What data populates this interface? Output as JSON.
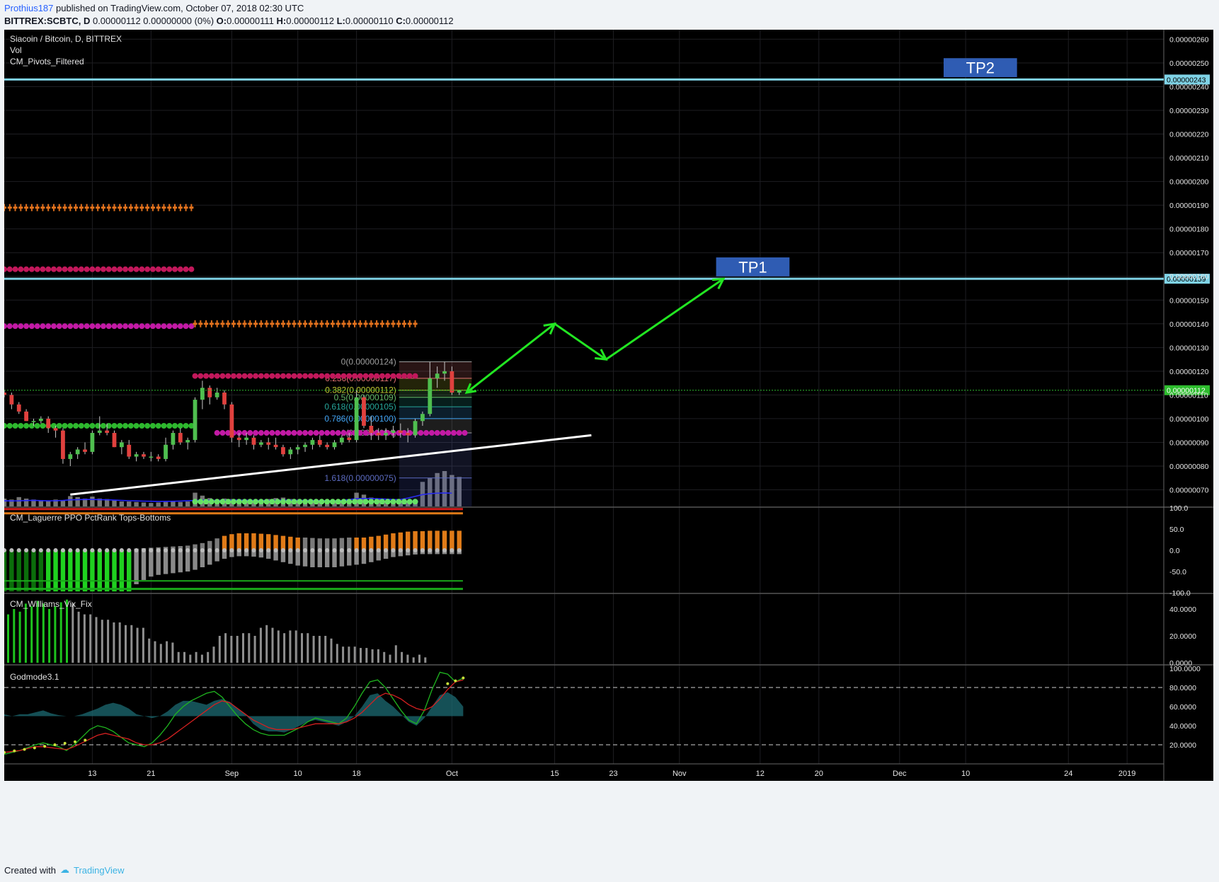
{
  "header": {
    "user": "Prothius187",
    "published": "published on TradingView.com, October 07, 2018 02:30 UTC",
    "symbol": "BITTREX:SCBTC, D",
    "change": "0.00000112 0.00000000 (0%)",
    "o_label": "O:",
    "o_value": "0.00000111",
    "h_label": "H:",
    "h_value": "0.00000112",
    "l_label": "L:",
    "l_value": "0.00000110",
    "c_label": "C:",
    "c_value": "0.00000112"
  },
  "footer": {
    "created": "Created with",
    "brand": "TradingView"
  },
  "chart_data": {
    "type": "candlestick",
    "title": "Siacoin / Bitcoin, D, BITTREX",
    "indicators": [
      "Vol",
      "CM_Pivots_Filtered"
    ],
    "price_axis": {
      "ticks": [
        "0.00000260",
        "0.00000250",
        "0.00000240",
        "0.00000230",
        "0.00000220",
        "0.00000210",
        "0.00000200",
        "0.00000190",
        "0.00000180",
        "0.00000170",
        "0.00000160",
        "0.00000150",
        "0.00000140",
        "0.00000130",
        "0.00000120",
        "0.00000110",
        "0.00000100",
        "0.00000090",
        "0.00000080",
        "0.00000070"
      ],
      "ylim": [
        6.3e-07,
        2.64e-06
      ]
    },
    "time_axis": {
      "ticks": [
        {
          "label": "13",
          "day": 12
        },
        {
          "label": "21",
          "day": 20
        },
        {
          "label": "Sep",
          "day": 31
        },
        {
          "label": "10",
          "day": 40
        },
        {
          "label": "18",
          "day": 48
        },
        {
          "label": "Oct",
          "day": 61
        },
        {
          "label": "15",
          "day": 75
        },
        {
          "label": "23",
          "day": 83
        },
        {
          "label": "Nov",
          "day": 92
        },
        {
          "label": "12",
          "day": 103
        },
        {
          "label": "20",
          "day": 111
        },
        {
          "label": "Dec",
          "day": 122
        },
        {
          "label": "10",
          "day": 131
        },
        {
          "label": "24",
          "day": 145
        },
        {
          "label": "2019",
          "day": 153
        }
      ],
      "xlim": [
        0,
        158
      ]
    },
    "levels": [
      {
        "price": 2.43e-06,
        "label": "0.00000243",
        "color": "#7fd3e6"
      },
      {
        "price": 1.59e-06,
        "label": "0.00000159",
        "color": "#7fd3e6"
      }
    ],
    "last_price": {
      "price": 1.12e-06,
      "label": "0.00000112",
      "color": "#2ebd2e"
    },
    "targets": [
      {
        "label": "TP2",
        "day_start": 128,
        "day_end": 138,
        "price_top": 2.52e-06,
        "price_bottom": 2.44e-06
      },
      {
        "label": "TP1",
        "day_start": 97,
        "day_end": 107,
        "price_top": 1.68e-06,
        "price_bottom": 1.6e-06
      }
    ],
    "forecast_path": [
      [
        63,
        1.11e-06
      ],
      [
        75,
        1.4e-06
      ],
      [
        82,
        1.25e-06
      ],
      [
        98,
        1.59e-06
      ]
    ],
    "trendline": [
      [
        9,
        6.8e-07
      ],
      [
        80,
        9.3e-07
      ]
    ],
    "fib_levels": [
      {
        "ratio": "0",
        "price": 1.24e-06,
        "label": "0(0.00000124)",
        "color": "#9e9e9e"
      },
      {
        "ratio": "0.236",
        "price": 1.17e-06,
        "label": "0.236(0.00000117)",
        "color": "#e57373"
      },
      {
        "ratio": "0.382",
        "price": 1.12e-06,
        "label": "0.382(0.00000112)",
        "color": "#c0ca33"
      },
      {
        "ratio": "0.5",
        "price": 1.09e-06,
        "label": "0.5(0.00000109)",
        "color": "#66bb6a"
      },
      {
        "ratio": "0.618",
        "price": 1.05e-06,
        "label": "0.618(0.00000105)",
        "color": "#26a69a"
      },
      {
        "ratio": "0.786",
        "price": 1e-06,
        "label": "0.786(0.00000100)",
        "color": "#42a5f5"
      },
      {
        "ratio": "1",
        "price": 9.4e-07,
        "label": "1(0.00000094)",
        "color": "#9e9e9e"
      },
      {
        "ratio": "1.618",
        "price": 7.5e-07,
        "label": "1.618(0.00000075)",
        "color": "#5c6bc0"
      }
    ],
    "pivots": [
      {
        "day_start": 0,
        "day_end": 26,
        "price": 1.89e-06,
        "style": "cross",
        "color": "#e2711d"
      },
      {
        "day_start": 0,
        "day_end": 26,
        "price": 1.63e-06,
        "style": "dot",
        "color": "#c2185b"
      },
      {
        "day_start": 0,
        "day_end": 26,
        "price": 1.39e-06,
        "style": "dot",
        "color": "#c21aa5"
      },
      {
        "day_start": 0,
        "day_end": 26,
        "price": 9.7e-07,
        "style": "dot",
        "color": "#2eb82e"
      },
      {
        "day_start": 26,
        "day_end": 56,
        "price": 1.4e-06,
        "style": "cross",
        "color": "#e2711d"
      },
      {
        "day_start": 26,
        "day_end": 56,
        "price": 1.18e-06,
        "style": "dot",
        "color": "#c2185b"
      },
      {
        "day_start": 29,
        "day_end": 63,
        "price": 9.4e-07,
        "style": "dot",
        "color": "#c21aa5"
      },
      {
        "day_start": 26,
        "day_end": 56,
        "price": 6.5e-07,
        "style": "dot",
        "color": "#66e066"
      }
    ],
    "candles": [
      [
        111,
        112,
        109,
        110
      ],
      [
        110,
        111,
        104,
        106
      ],
      [
        106,
        107,
        102,
        103
      ],
      [
        103,
        104,
        99,
        99
      ],
      [
        99,
        100,
        97,
        99
      ],
      [
        99,
        101,
        98,
        100
      ],
      [
        100,
        101,
        94,
        96
      ],
      [
        96,
        97,
        92,
        95
      ],
      [
        95,
        96,
        81,
        83
      ],
      [
        83,
        86,
        80,
        85
      ],
      [
        85,
        88,
        83,
        87
      ],
      [
        87,
        90,
        85,
        86
      ],
      [
        86,
        95,
        85,
        94
      ],
      [
        94,
        101,
        93,
        95
      ],
      [
        95,
        98,
        93,
        94
      ],
      [
        94,
        95,
        88,
        88
      ],
      [
        88,
        91,
        85,
        90
      ],
      [
        89,
        91,
        83,
        84
      ],
      [
        84,
        86,
        82,
        85
      ],
      [
        85,
        86,
        83,
        84
      ],
      [
        84,
        86,
        82,
        84
      ],
      [
        84,
        85,
        82,
        83
      ],
      [
        83,
        92,
        82,
        89
      ],
      [
        89,
        95,
        87,
        94
      ],
      [
        94,
        96,
        89,
        90
      ],
      [
        90,
        92,
        87,
        91
      ],
      [
        91,
        109,
        90,
        108
      ],
      [
        108,
        116,
        104,
        113
      ],
      [
        113,
        114,
        106,
        109
      ],
      [
        109,
        113,
        108,
        111
      ],
      [
        111,
        112,
        104,
        106
      ],
      [
        106,
        107,
        90,
        92
      ],
      [
        92,
        94,
        88,
        91
      ],
      [
        91,
        94,
        89,
        92
      ],
      [
        92,
        93,
        87,
        89
      ],
      [
        89,
        91,
        88,
        90
      ],
      [
        90,
        92,
        87,
        89
      ],
      [
        89,
        92,
        87,
        88
      ],
      [
        88,
        89,
        84,
        85
      ],
      [
        85,
        88,
        83,
        87
      ],
      [
        87,
        89,
        85,
        88
      ],
      [
        88,
        90,
        86,
        89
      ],
      [
        89,
        92,
        87,
        91
      ],
      [
        91,
        93,
        88,
        89
      ],
      [
        89,
        90,
        87,
        88
      ],
      [
        88,
        91,
        87,
        90
      ],
      [
        90,
        93,
        89,
        92
      ],
      [
        92,
        94,
        90,
        91
      ],
      [
        91,
        112,
        90,
        109
      ],
      [
        109,
        110,
        96,
        97
      ],
      [
        97,
        101,
        91,
        94
      ],
      [
        94,
        96,
        91,
        93
      ],
      [
        93,
        96,
        91,
        94
      ],
      [
        94,
        97,
        92,
        95
      ],
      [
        95,
        98,
        92,
        94
      ],
      [
        94,
        96,
        90,
        93
      ],
      [
        93,
        100,
        92,
        99
      ],
      [
        99,
        103,
        97,
        102
      ],
      [
        102,
        124,
        101,
        117
      ],
      [
        117,
        122,
        113,
        119
      ],
      [
        119,
        124,
        116,
        120
      ],
      [
        120,
        122,
        110,
        111
      ],
      [
        111,
        112,
        110,
        112
      ]
    ],
    "candle_scale": 1e-08,
    "volume": [
      16,
      14,
      19,
      16,
      14,
      13,
      12,
      14,
      13,
      21,
      19,
      16,
      20,
      16,
      15,
      12,
      10,
      10,
      9,
      8,
      7,
      8,
      9,
      10,
      9,
      10,
      28,
      22,
      17,
      14,
      16,
      15,
      14,
      12,
      10,
      11,
      15,
      17,
      18,
      15,
      12,
      12,
      12,
      11,
      10,
      9,
      12,
      13,
      28,
      24,
      18,
      16,
      12,
      12,
      11,
      11,
      10,
      50,
      58,
      68,
      72,
      64,
      60
    ],
    "volume_ma": [
      11.5,
      11.2,
      11.4,
      12.0,
      12.3,
      11.8,
      11.5,
      11.6,
      12.1,
      13.4,
      13.8,
      14.2,
      14.1,
      13.8,
      13.5,
      12.9,
      12.2,
      11.7,
      11.2,
      10.8,
      10.5,
      10.2,
      10.3,
      10.5,
      10.9,
      11.6,
      12.2,
      12.8,
      12.6,
      12.3,
      12.5,
      12.8,
      12.9,
      12.7,
      12.4,
      12.2,
      12.3,
      12.5,
      12.8,
      12.9,
      12.6,
      12.4,
      12.1,
      11.8,
      11.6,
      11.5,
      12.0,
      14.0,
      15.8,
      16.2,
      16.0,
      15.5,
      14.8,
      14.2,
      14.0,
      17.0,
      20.5,
      24.0,
      26.0,
      27.0,
      27.5,
      27.0
    ],
    "panes": [
      {
        "name": "CM_Laguerre PPO PctRank Tops-Bottoms",
        "ticks": [
          "100.0",
          "50.0",
          "0.0",
          "-50.0",
          "-100.0"
        ],
        "ylim": [
          -100,
          100
        ],
        "top_series": [
          0,
          0,
          0,
          0,
          0,
          0,
          0,
          0,
          0,
          0,
          0,
          0,
          0,
          0,
          0,
          0,
          0,
          0,
          4,
          5,
          6,
          7,
          8,
          9,
          10,
          11,
          14,
          17,
          22,
          28,
          34,
          38,
          40,
          40,
          40,
          39,
          38,
          36,
          34,
          32,
          30,
          30,
          29,
          28,
          28,
          28,
          29,
          30,
          30,
          30,
          32,
          34,
          37,
          40,
          42,
          44,
          45,
          45,
          46,
          46,
          46,
          46,
          46
        ],
        "bottom_series": [
          -97,
          -97,
          -97,
          -97,
          -97,
          -97,
          -97,
          -97,
          -97,
          -97,
          -97,
          -97,
          -97,
          -97,
          -97,
          -97,
          -97,
          -97,
          -80,
          -70,
          -62,
          -58,
          -56,
          -54,
          -52,
          -50,
          -46,
          -40,
          -34,
          -26,
          -20,
          -16,
          -14,
          -14,
          -15,
          -17,
          -20,
          -24,
          -28,
          -32,
          -36,
          -38,
          -40,
          -40,
          -40,
          -40,
          -38,
          -36,
          -34,
          -32,
          -28,
          -24,
          -20,
          -16,
          -14,
          -12,
          -10,
          -9,
          -9,
          -9,
          -9,
          -9,
          -9
        ],
        "top_hl": [
          -72,
          -91
        ]
      },
      {
        "name": "CM_Williams_Vix_Fix",
        "ticks": [
          "40.0000",
          "20.0000",
          "0.0000"
        ],
        "ylim": [
          0,
          50
        ],
        "values": [
          36,
          40,
          38,
          44,
          42,
          46,
          44,
          40,
          42,
          45,
          47,
          44,
          38,
          36,
          36,
          34,
          32,
          32,
          30,
          30,
          28,
          28,
          26,
          26,
          18,
          16,
          14,
          16,
          15,
          8,
          8,
          6,
          8,
          6,
          8,
          12,
          20,
          22,
          20,
          20,
          22,
          22,
          20,
          26,
          28,
          26,
          24,
          22,
          24,
          24,
          22,
          22,
          20,
          20,
          20,
          18,
          14,
          12,
          12,
          12,
          11,
          11,
          10,
          10,
          8,
          6,
          13,
          8,
          6,
          4,
          6,
          4
        ],
        "green_count": 11
      },
      {
        "name": "Godmode3.1",
        "ticks": [
          "100.0000",
          "80.0000",
          "60.0000",
          "40.0000",
          "20.0000"
        ],
        "ylim": [
          0,
          103
        ],
        "dashed_levels": [
          80,
          20
        ],
        "fill_series": [
          52,
          50,
          52,
          52,
          54,
          56,
          53,
          51,
          50,
          50,
          52,
          55,
          58,
          62,
          64,
          62,
          58,
          52,
          50,
          48,
          50,
          55,
          62,
          66,
          66,
          64,
          62,
          66,
          68,
          65,
          58,
          52,
          42,
          36,
          34,
          34,
          33,
          36,
          40,
          44,
          46,
          44,
          42,
          40,
          44,
          50,
          60,
          72,
          74,
          66,
          60,
          52,
          44,
          40,
          48,
          60,
          72,
          75,
          70,
          60
        ],
        "red_series": [
          12,
          13,
          14,
          16,
          18,
          18,
          17,
          16,
          15,
          18,
          22,
          26,
          30,
          32,
          30,
          28,
          26,
          22,
          20,
          20,
          22,
          26,
          32,
          38,
          44,
          50,
          56,
          62,
          66,
          64,
          58,
          52,
          46,
          42,
          38,
          36,
          36,
          36,
          38,
          40,
          42,
          42,
          42,
          42,
          44,
          48,
          54,
          62,
          70,
          74,
          72,
          68,
          62,
          58,
          56,
          60,
          68,
          78,
          86,
          88
        ],
        "green_series": [
          10,
          12,
          14,
          17,
          20,
          22,
          20,
          18,
          14,
          20,
          28,
          36,
          40,
          38,
          34,
          28,
          22,
          20,
          18,
          22,
          30,
          40,
          52,
          60,
          66,
          70,
          74,
          76,
          70,
          60,
          50,
          42,
          36,
          32,
          30,
          30,
          30,
          34,
          38,
          44,
          48,
          46,
          44,
          42,
          48,
          60,
          74,
          86,
          88,
          80,
          68,
          56,
          46,
          42,
          56,
          78,
          96,
          94,
          86,
          90
        ]
      }
    ]
  }
}
